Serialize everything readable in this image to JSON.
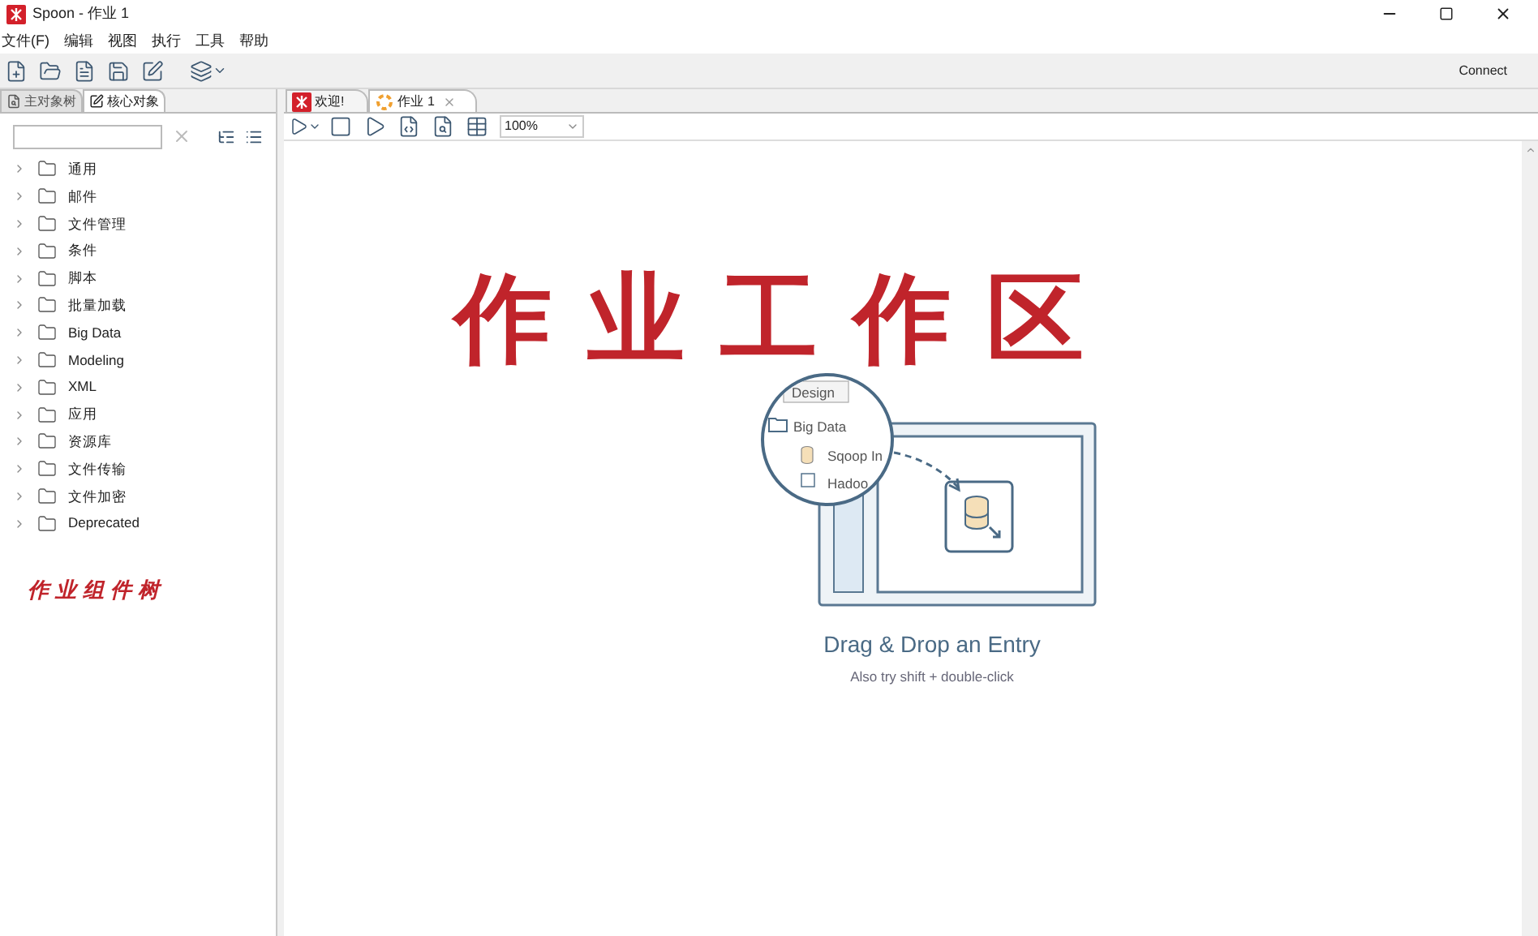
{
  "window": {
    "title": "Spoon - 作业 1"
  },
  "menu": [
    "文件(F)",
    "编辑",
    "视图",
    "执行",
    "工具",
    "帮助"
  ],
  "toolbar": {
    "connect": "Connect"
  },
  "left_tabs": [
    {
      "label": "主对象树",
      "selected": false
    },
    {
      "label": "核心对象",
      "selected": true
    }
  ],
  "tree": [
    {
      "label": "通用",
      "expanded": false
    },
    {
      "label": "邮件",
      "expanded": false
    },
    {
      "label": "文件管理",
      "expanded": false
    },
    {
      "label": "条件",
      "expanded": false
    },
    {
      "label": "脚本",
      "expanded": false
    },
    {
      "label": "批量加载",
      "expanded": false
    },
    {
      "label": "Big Data",
      "expanded": false
    },
    {
      "label": "Modeling",
      "expanded": false
    },
    {
      "label": "XML",
      "expanded": false
    },
    {
      "label": "应用",
      "expanded": false
    },
    {
      "label": "资源库",
      "expanded": false
    },
    {
      "label": "文件传输",
      "expanded": false
    },
    {
      "label": "文件加密",
      "expanded": false
    },
    {
      "label": "Deprecated",
      "expanded": false
    }
  ],
  "left_annotation": "作业组件树",
  "editor_tabs": [
    {
      "label": "欢迎!",
      "selected": false,
      "kind": "welcome"
    },
    {
      "label": "作业 1",
      "selected": true,
      "kind": "job"
    }
  ],
  "zoom": "100%",
  "illustration": {
    "tab": "Design",
    "folder": "Big Data",
    "items": [
      "Sqoop In",
      "Hadoo"
    ]
  },
  "empty_state": {
    "title": "Drag & Drop an Entry",
    "hint": "Also try shift + double-click"
  },
  "canvas_annotation": "作业工作区"
}
